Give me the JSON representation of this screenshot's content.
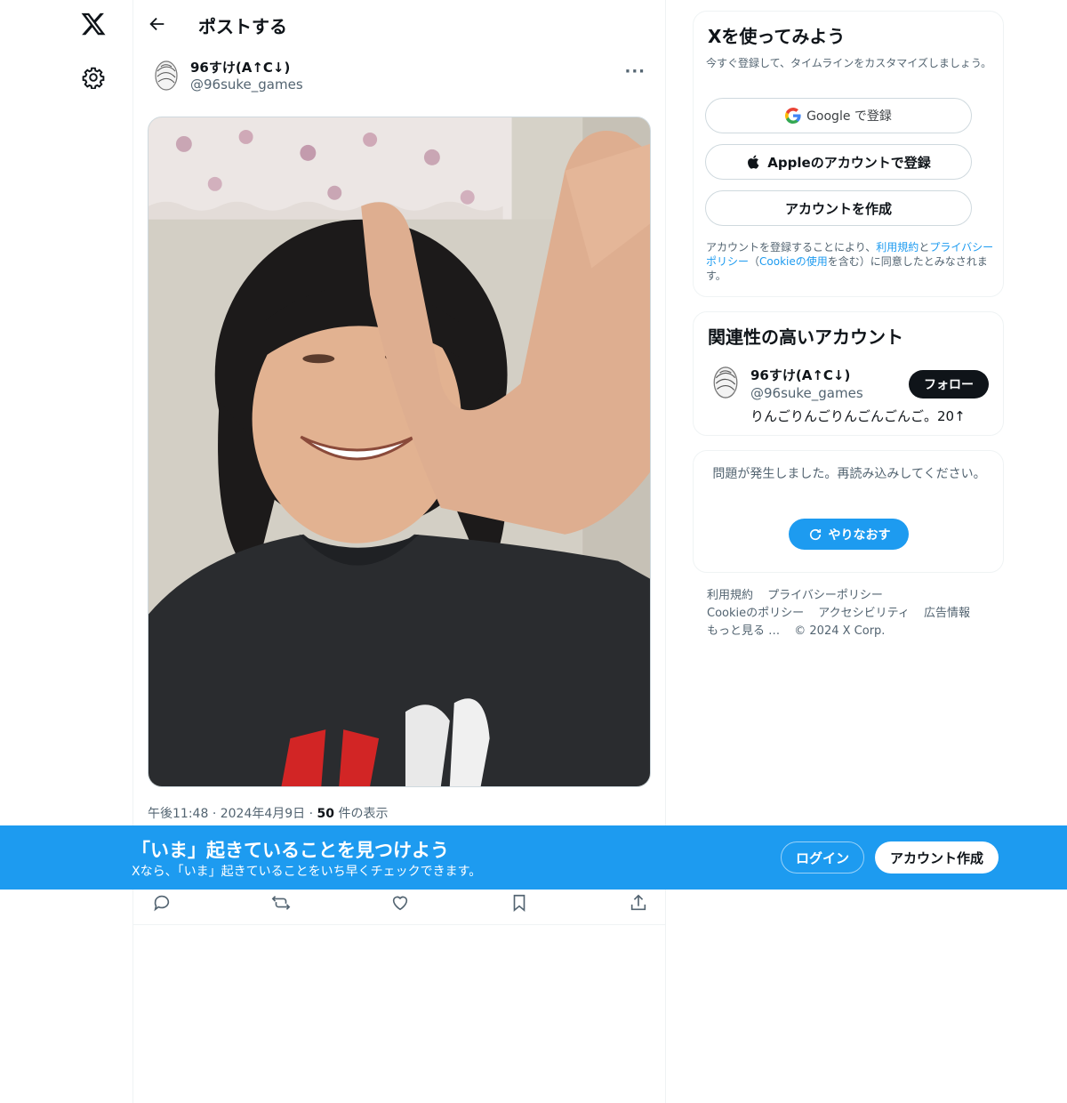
{
  "header": {
    "title": "ポストする"
  },
  "post": {
    "author_name": "96すけ(A↑C↓)",
    "author_handle": "@96suke_games",
    "more_label": "···",
    "time": "午後11:48",
    "date": "2024年4月9日",
    "views_count": "50",
    "views_label": "件の表示",
    "separator": "·"
  },
  "signup_card": {
    "title": "Xを使ってみよう",
    "subtitle": "今すぐ登録して、タイムラインをカスタマイズしましょう。",
    "google_label": "Google で登録",
    "apple_label": "Appleのアカウントで登録",
    "create_label": "アカウントを作成",
    "legal_prefix": "アカウントを登録することにより、",
    "legal_terms": "利用規約",
    "legal_and": "と",
    "legal_privacy": "プライバシーポリシー",
    "legal_paren_open": "（",
    "legal_cookie": "Cookieの使用",
    "legal_suffix": "を含む）に同意したとみなされます。"
  },
  "relevant_card": {
    "title": "関連性の高いアカウント",
    "name": "96すけ(A↑C↓)",
    "handle": "@96suke_games",
    "bio": "りんごりんごりんごんごんご。20↑",
    "follow_label": "フォロー"
  },
  "error_card": {
    "message": "問題が発生しました。再読み込みしてください。",
    "retry_label": "やりなおす"
  },
  "footer": {
    "links": [
      "利用規約",
      "プライバシーポリシー",
      "Cookieのポリシー",
      "アクセシビリティ",
      "広告情報",
      "もっと見る …",
      "© 2024 X Corp."
    ]
  },
  "banner": {
    "title": "「いま」起きていることを見つけよう",
    "subtitle": "Xなら、「いま」起きていることをいち早くチェックできます。",
    "login_label": "ログイン",
    "signup_label": "アカウント作成"
  },
  "colors": {
    "accent": "#1d9bf0",
    "text": "#0f1419",
    "muted": "#536471",
    "border": "#eff3f4"
  }
}
